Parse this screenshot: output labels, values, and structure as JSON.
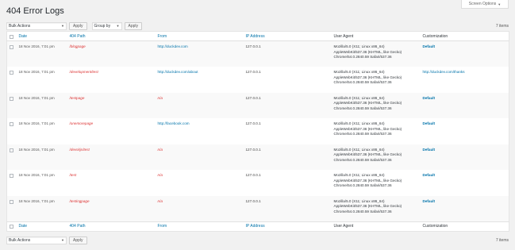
{
  "screen_options": {
    "label": "Screen Options"
  },
  "page_title": "404 Error Logs",
  "toolbar": {
    "bulk_actions": "Bulk Actions",
    "apply": "Apply",
    "group_by": "Group by",
    "count": "7 items"
  },
  "columns": {
    "date": "Date",
    "path": "404 Path",
    "from": "From",
    "ip": "IP Address",
    "agent": "User Agent",
    "custom": "Customization"
  },
  "rows": [
    {
      "date": "18 Nov 2016, 7:01 pm",
      "path": "/blogpage",
      "from": "http://duckdev.com",
      "ip": "127.0.0.1",
      "agent": [
        "Mozilla/5.0 (X11; Linux x86_64)",
        "AppleWebKit/537.36 (KHTML, like Gecko)",
        "Chrome/54.0.2840.59 Safari/537.36"
      ],
      "custom": "Default"
    },
    {
      "date": "18 Nov 2016, 7:01 pm",
      "path": "/development/test",
      "from": "http://duckdev.com/about",
      "ip": "127.0.0.1",
      "agent": [
        "Mozilla/5.0 (X11; Linux x86_64)",
        "AppleWebKit/537.36 (KHTML, like Gecko)",
        "Chrome/54.0.2840.59 Safari/537.36"
      ],
      "custom": "http://duckdev.com/thanks"
    },
    {
      "date": "18 Nov 2016, 7:01 pm",
      "path": "/testpage",
      "from": "n/a",
      "ip": "127.0.0.1",
      "agent": [
        "Mozilla/5.0 (X11; Linux x86_64)",
        "AppleWebKit/537.36 (KHTML, like Gecko)",
        "Chrome/54.0.2840.59 Safari/537.36"
      ],
      "custom": "Default"
    },
    {
      "date": "18 Nov 2016, 7:01 pm",
      "path": "/onemorepage",
      "from": "http://facebook.com",
      "ip": "127.0.0.1",
      "agent": [
        "Mozilla/5.0 (X11; Linux x86_64)",
        "AppleWebKit/537.36 (KHTML, like Gecko)",
        "Chrome/54.0.2840.59 Safari/537.36"
      ],
      "custom": "Default"
    },
    {
      "date": "18 Nov 2016, 7:01 pm",
      "path": "/devskjs/test",
      "from": "n/a",
      "ip": "127.0.0.1",
      "agent": [
        "Mozilla/5.0 (X11; Linux x86_64)",
        "AppleWebKit/537.36 (KHTML, like Gecko)",
        "Chrome/54.0.2840.59 Safari/537.36"
      ],
      "custom": "Default"
    },
    {
      "date": "18 Nov 2016, 7:01 pm",
      "path": "/test",
      "from": "n/a",
      "ip": "127.0.0.1",
      "agent": [
        "Mozilla/5.0 (X11; Linux x86_64)",
        "AppleWebKit/537.36 (KHTML, like Gecko)",
        "Chrome/54.0.2840.59 Safari/537.36"
      ],
      "custom": "Default"
    },
    {
      "date": "18 Nov 2016, 7:01 pm",
      "path": "/testingpage",
      "from": "n/a",
      "ip": "127.0.0.1",
      "agent": [
        "Mozilla/5.0 (X11; Linux x86_64)",
        "AppleWebKit/537.36 (KHTML, like Gecko)",
        "Chrome/54.0.2840.59 Safari/537.36"
      ],
      "custom": "Default"
    }
  ]
}
